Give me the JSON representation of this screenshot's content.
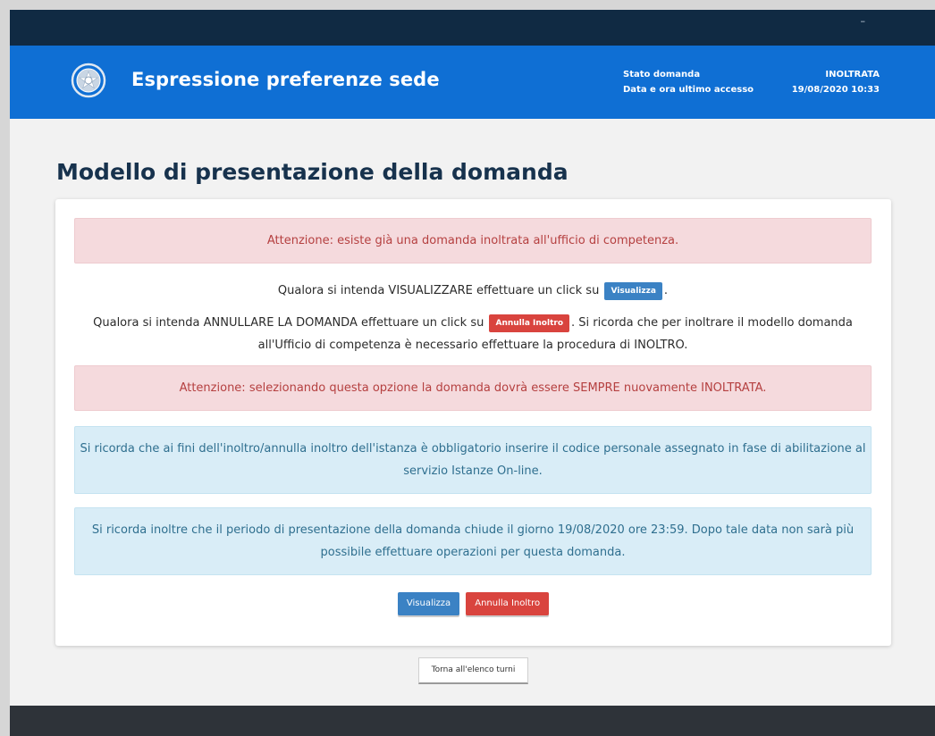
{
  "window": {
    "minimize_glyph": "–"
  },
  "header": {
    "title": "Espressione preferenze sede",
    "emblem_icon": "italian-republic-emblem-icon",
    "status_label": "Stato domanda",
    "status_value": "INOLTRATA",
    "last_access_label": "Data e ora ultimo accesso",
    "last_access_value": "19/08/2020 10:33"
  },
  "main": {
    "page_title": "Modello di presentazione della domanda",
    "alert_existing": "Attenzione: esiste già una domanda inoltrata all'ufficio di competenza.",
    "view_text_before": "Qualora si intenda VISUALIZZARE effettuare un click su",
    "view_inline_button": "Visualizza",
    "view_text_after": ".",
    "cancel_text_before": "Qualora si intenda ANNULLARE LA DOMANDA effettuare un click su",
    "cancel_inline_button": "Annulla Inoltro",
    "cancel_text_after": ". Si ricorda che per inoltrare il modello domanda all'Ufficio di competenza è necessario effettuare la procedura di INOLTRO.",
    "alert_warning": "Attenzione: selezionando questa opzione la domanda dovrà essere SEMPRE nuovamente INOLTRATA.",
    "info_code": "Si ricorda che ai fini dell'inoltro/annulla inoltro dell'istanza è obbligatorio inserire il codice personale assegnato in fase di abilitazione al servizio Istanze On-line.",
    "info_deadline": "Si ricorda inoltre che il periodo di presentazione della domanda chiude il giorno 19/08/2020 ore 23:59. Dopo tale data non sarà più possibile effettuare operazioni per questa domanda.",
    "view_button": "Visualizza",
    "cancel_button": "Annulla Inoltro",
    "back_button": "Torna all'elenco turni"
  },
  "colors": {
    "header_blue": "#0f6fd4",
    "topbar_navy": "#102a43",
    "primary_button": "#3b82c4",
    "danger_button": "#d9443e",
    "footer": "#2e3339"
  }
}
